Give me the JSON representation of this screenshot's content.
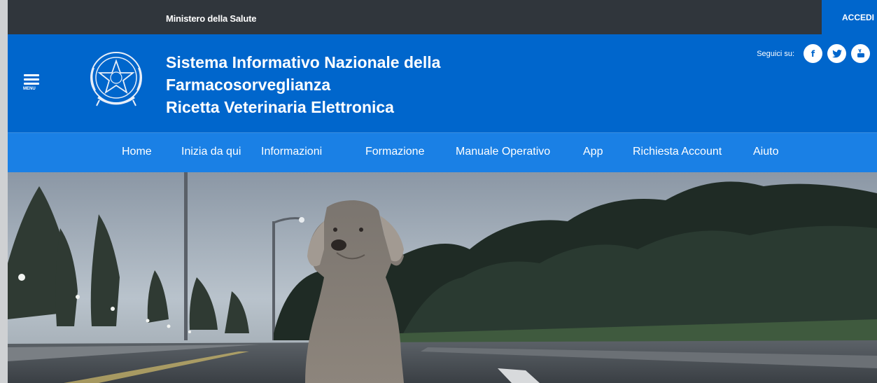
{
  "topbar": {
    "ministry": "Ministero della Salute",
    "login_label": "ACCEDI"
  },
  "header": {
    "menu_label": "MENU",
    "title_lines": [
      "Sistema Informativo Nazionale della",
      "Farmacosorveglianza",
      "Ricetta Veterinaria Elettronica"
    ],
    "social_label": "Seguici su:",
    "social_icons": [
      "facebook-icon",
      "twitter-icon",
      "youtube-icon"
    ]
  },
  "nav": {
    "items": [
      {
        "label": "Home"
      },
      {
        "label": "Inizia da qui"
      },
      {
        "label": "Informazioni"
      },
      {
        "label": "Formazione"
      },
      {
        "label": "Manuale Operativo"
      },
      {
        "label": "App"
      },
      {
        "label": "Richiesta Account"
      },
      {
        "label": "Aiuto"
      }
    ]
  },
  "colors": {
    "topbar": "#30363c",
    "brand": "#0066cc",
    "nav": "#1a80e5"
  }
}
